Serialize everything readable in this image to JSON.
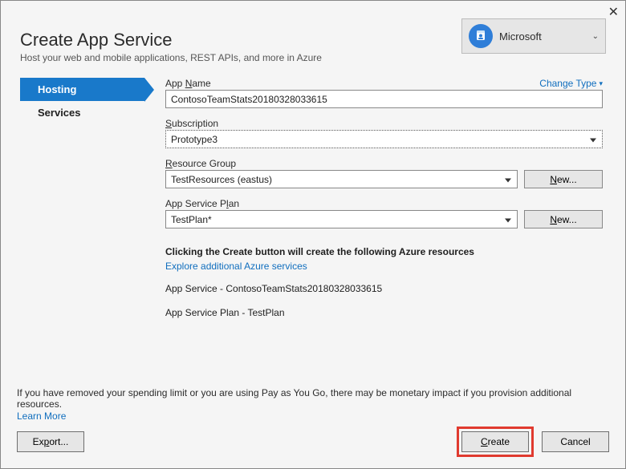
{
  "window": {
    "title": "Create App Service",
    "subtitle": "Host your web and mobile applications, REST APIs, and more in Azure"
  },
  "account": {
    "label": "Microsoft"
  },
  "sidebar": {
    "items": [
      {
        "label": "Hosting",
        "active": true
      },
      {
        "label": "Services",
        "active": false
      }
    ]
  },
  "fields": {
    "app_name": {
      "label_prefix": "App ",
      "label_accesskey": "N",
      "label_suffix": "ame",
      "value": "ContosoTeamStats20180328033615",
      "change_type": "Change Type"
    },
    "subscription": {
      "label_prefix": "",
      "label_accesskey": "S",
      "label_suffix": "ubscription",
      "value": "Prototype3"
    },
    "resource_group": {
      "label_prefix": "",
      "label_accesskey": "R",
      "label_suffix": "esource Group",
      "value": "TestResources (eastus)",
      "new_label_prefix": "N",
      "new_label_suffix": "ew..."
    },
    "app_service_plan": {
      "label_prefix": "App Service P",
      "label_accesskey": "l",
      "label_suffix": "an",
      "value": "TestPlan*",
      "new_label_prefix": "N",
      "new_label_suffix": "ew..."
    }
  },
  "summary": {
    "title": "Clicking the Create button will create the following Azure resources",
    "explore_link": "Explore additional Azure services",
    "lines": [
      "App Service - ContosoTeamStats20180328033615",
      "App Service Plan - TestPlan"
    ]
  },
  "footer": {
    "note": "If you have removed your spending limit or you are using Pay as You Go, there may be monetary impact if you provision additional resources.",
    "learn_more": "Learn More",
    "export_prefix": "Ex",
    "export_accesskey": "p",
    "export_suffix": "ort...",
    "create_prefix": "",
    "create_accesskey": "C",
    "create_suffix": "reate",
    "cancel": "Cancel"
  }
}
